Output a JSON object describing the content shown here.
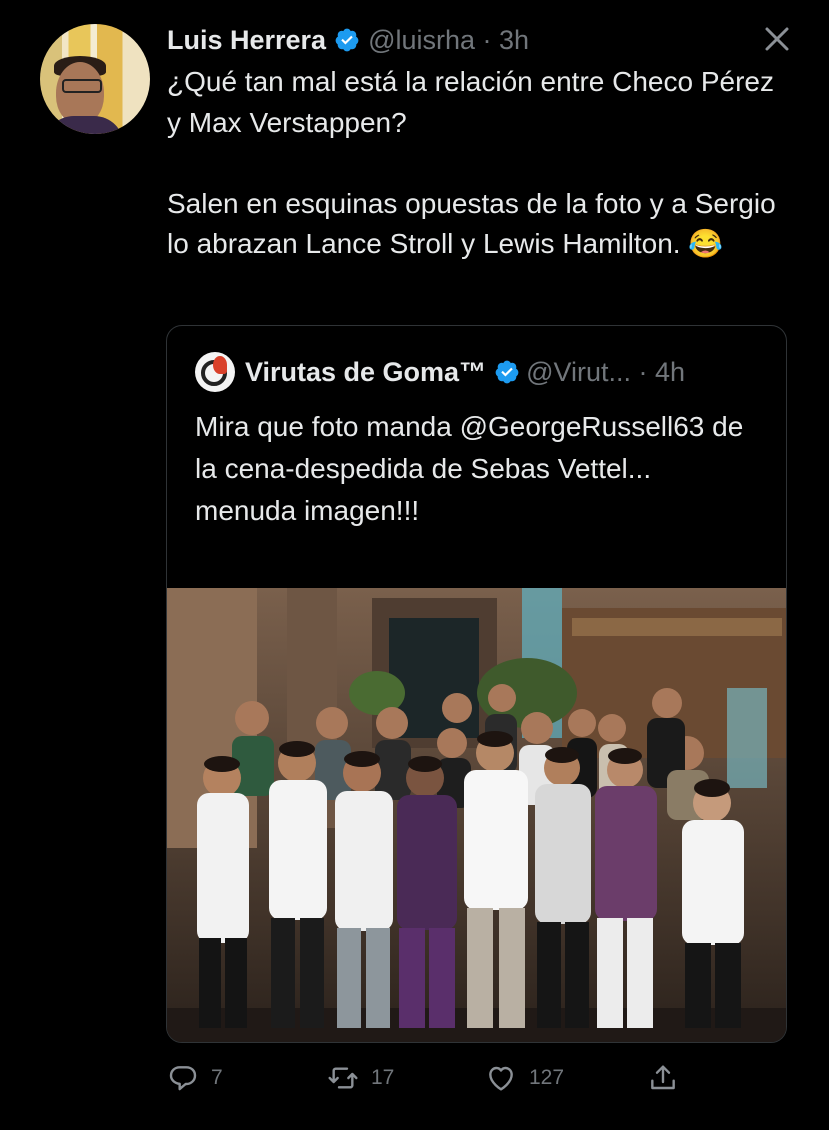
{
  "tweet": {
    "author_name": "Luis Herrera",
    "author_handle_time": "@luisrha · 3h",
    "text": "¿Qué tan mal está la relación entre Checo Pérez y Max Verstappen?\n\nSalen en esquinas opuestas de la foto y a Sergio lo abrazan Lance Stroll y Lewis Hamilton. 😂"
  },
  "quoted": {
    "author_name": "Virutas de Goma™",
    "author_handle_time": "@Virut... · 4h",
    "text": "Mira que foto manda @GeorgeRussell63 de la cena-despedida de Sebas Vettel... menuda imagen!!!"
  },
  "actions": {
    "replies": "7",
    "retweets": "17",
    "likes": "127"
  },
  "colors": {
    "background": "#000000",
    "text": "#e7e9ea",
    "muted": "#71767b",
    "verified": "#1d9bf0",
    "border": "#2f3336"
  }
}
